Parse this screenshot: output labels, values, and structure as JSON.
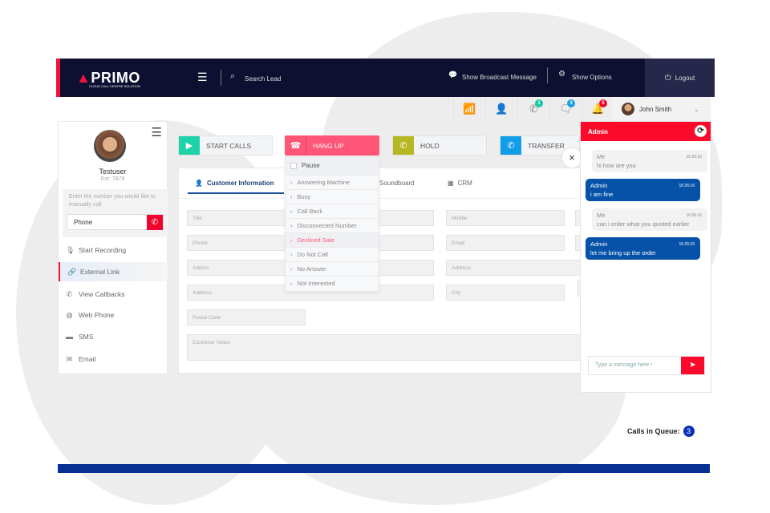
{
  "header": {
    "logo": "PRIMO",
    "logo_tagline": "CLOUD CALL CENTRE SOLUTION",
    "search_label": "Search Lead",
    "broadcast": "Show Broadcast Message",
    "options": "Show Options",
    "logout": "Logout"
  },
  "iconbar": [
    {
      "icon": "chart-icon",
      "badge": null
    },
    {
      "icon": "users-icon",
      "badge": null
    },
    {
      "icon": "callback-icon",
      "badge": "1",
      "color": "#14c9a5"
    },
    {
      "icon": "chat-icon",
      "badge": "3",
      "color": "#14a0e6"
    },
    {
      "icon": "bell-icon",
      "badge": "5",
      "color": "#f0062c"
    }
  ],
  "user": {
    "name": "John Smith"
  },
  "sidebar": {
    "name": "Testuser",
    "ext": "Ext: 7878",
    "manual_hint": "Enter the number you would like to manually call",
    "phone_value": "Phone",
    "items": [
      {
        "label": "Start Recording",
        "icon": "microphone-icon"
      },
      {
        "label": "External Link",
        "icon": "link-icon",
        "active": true
      },
      {
        "label": "View Callbacks",
        "icon": "callback-icon"
      },
      {
        "label": "Web Phone",
        "icon": "globe-icon"
      },
      {
        "label": "SMS",
        "icon": "sms-icon"
      },
      {
        "label": "Email",
        "icon": "email-icon"
      }
    ]
  },
  "actions": {
    "start": {
      "label": "START CALLS",
      "color": "#1dd3a7"
    },
    "hangup": {
      "label": "HANG UP",
      "color": "#ff5577"
    },
    "hold": {
      "label": "HOLD",
      "color": "#b5b820"
    },
    "transfer": {
      "label": "TRANSFER",
      "color": "#109ee8"
    }
  },
  "hangup_menu": {
    "pause": "Pause",
    "items": [
      "Answering Machine",
      "Busy",
      "Call Back",
      "Disconnected Number",
      "Declined Sale",
      "Do Not Call",
      "No Answer",
      "Not Interested"
    ],
    "highlighted": "Declined Sale"
  },
  "tabs": [
    "Customer Information",
    "Soundboard",
    "CRM"
  ],
  "fields": {
    "title": "Title",
    "middle": "Middle",
    "phone": "Phone",
    "email": "Email",
    "addres": "Addres",
    "address2": "Address",
    "address": "Address",
    "city": "City",
    "postal": "Postal Code",
    "notes": "Customer Notes"
  },
  "chat": {
    "title": "Admin",
    "messages": [
      {
        "from": "Me",
        "time": "16:26:16",
        "text": "hi how are you"
      },
      {
        "from": "Admin",
        "time": "16:26:16",
        "text": "i am fine"
      },
      {
        "from": "Me",
        "time": "16:26:16",
        "text": "can i order what you quoted earlier"
      },
      {
        "from": "Admin",
        "time": "16:26:16",
        "text": "let me bring up the order"
      }
    ],
    "placeholder": "Type a message here !"
  },
  "queue": {
    "label": "Calls in Queue:",
    "count": "3"
  }
}
